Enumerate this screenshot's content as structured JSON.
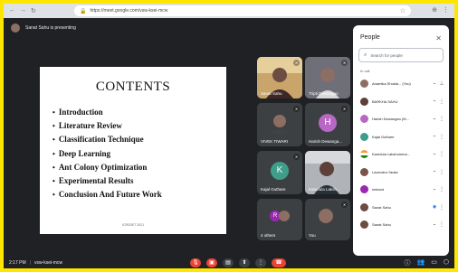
{
  "browser": {
    "url": "https://meet.google.com/vsw-ksei-mcw"
  },
  "presenting": {
    "text": "Sanat Sahu is presenting"
  },
  "slide": {
    "title": "CONTENTS",
    "items": [
      "Introduction",
      "Literature Review",
      "Classification Technique",
      "Deep Learning",
      "Ant Colony Optimization",
      "Experimental Results",
      "Conclusion And Future Work"
    ],
    "footer": "ICRDSET 2021"
  },
  "tiles": [
    {
      "name": "Sanat Sahu",
      "kind": "photo"
    },
    {
      "name": "Tripti Dewangan",
      "kind": "photo"
    },
    {
      "name": "VIVEK TIWARI",
      "kind": "photo"
    },
    {
      "name": "Harish Dewanga...",
      "kind": "letter",
      "letter": "H",
      "color": "#b868c4"
    },
    {
      "name": "Kajal Guthare",
      "kind": "letter",
      "letter": "K",
      "color": "#3f9e8a"
    },
    {
      "name": "Kamdula Laksh...",
      "kind": "photo"
    },
    {
      "name": "4 others",
      "kind": "others"
    },
    {
      "name": "You",
      "kind": "photo"
    }
  ],
  "meeting": {
    "time": "2:17 PM",
    "code": "vsw-ksei-mcw"
  },
  "people_panel": {
    "title": "People",
    "search_placeholder": "Search for people",
    "section": "In call",
    "people": [
      {
        "name": "Anamika Shukla... (You)",
        "avatar_color": "#8d6e63"
      },
      {
        "name": "BARKHA SAHU",
        "avatar_color": "#5d4037"
      },
      {
        "name": "Harish Dewangan (M...",
        "avatar_color": "#b868c4"
      },
      {
        "name": "Kajal Guthare",
        "avatar_color": "#3f9e8a"
      },
      {
        "name": "Kamdula Lakshumma...",
        "avatar_color": "#ff9933"
      },
      {
        "name": "Lavendra Yadav",
        "avatar_color": "#795548"
      },
      {
        "name": "nishant",
        "avatar_color": "#9c27b0"
      },
      {
        "name": "Sanat Sahu",
        "avatar_color": "#6d4c41"
      },
      {
        "name": "Sanat Sahu",
        "avatar_color": "#6d4c41"
      }
    ]
  }
}
